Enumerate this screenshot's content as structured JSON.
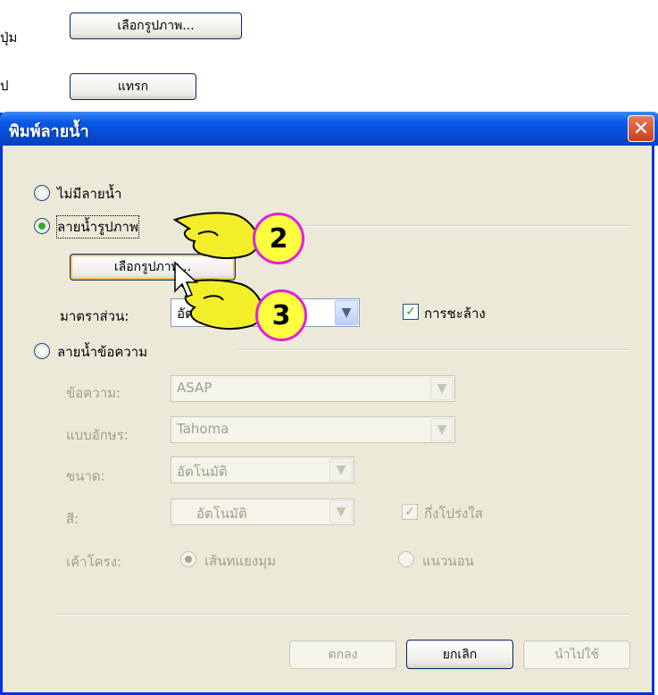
{
  "top": {
    "label1": "ปุ่ม",
    "button1": "เลือกรูปภาพ...",
    "label2": "ป",
    "button2": "แทรก"
  },
  "dialog": {
    "title": "พิมพ์ลายน้ำ",
    "close_icon": "close-icon",
    "no_watermark": "ไม่มีลายน้ำ",
    "picture_watermark": "ลายน้ำรูปภาพ",
    "select_picture": "เลือกรูปภาพ...",
    "scale_label": "มาตราส่วน:",
    "scale_value": "อัต",
    "washout": "การชะล้าง",
    "text_watermark": "ลายน้ำข้อความ",
    "text_label": "ข้อความ:",
    "text_value": "ASAP",
    "font_label": "แบบอักษร:",
    "font_value": "Tahoma",
    "size_label": "ขนาด:",
    "size_value": "อัตโนมัติ",
    "color_label": "สี:",
    "color_value": "อัตโนมัติ",
    "semitransparent": "กึ่งโปร่งใส",
    "layout_label": "เค้าโครง:",
    "diagonal": "เส้นทแยงมุม",
    "horizontal": "แนวนอน",
    "ok": "ตกลง",
    "cancel": "ยกเลิก",
    "apply": "นำไปใช้"
  },
  "markers": {
    "step2": "2",
    "step3": "3"
  },
  "colors": {
    "title_bar": "#0348cf",
    "marker_fill": "#ffff40",
    "marker_border": "#e020e0",
    "hand": "#f2ee2a"
  }
}
